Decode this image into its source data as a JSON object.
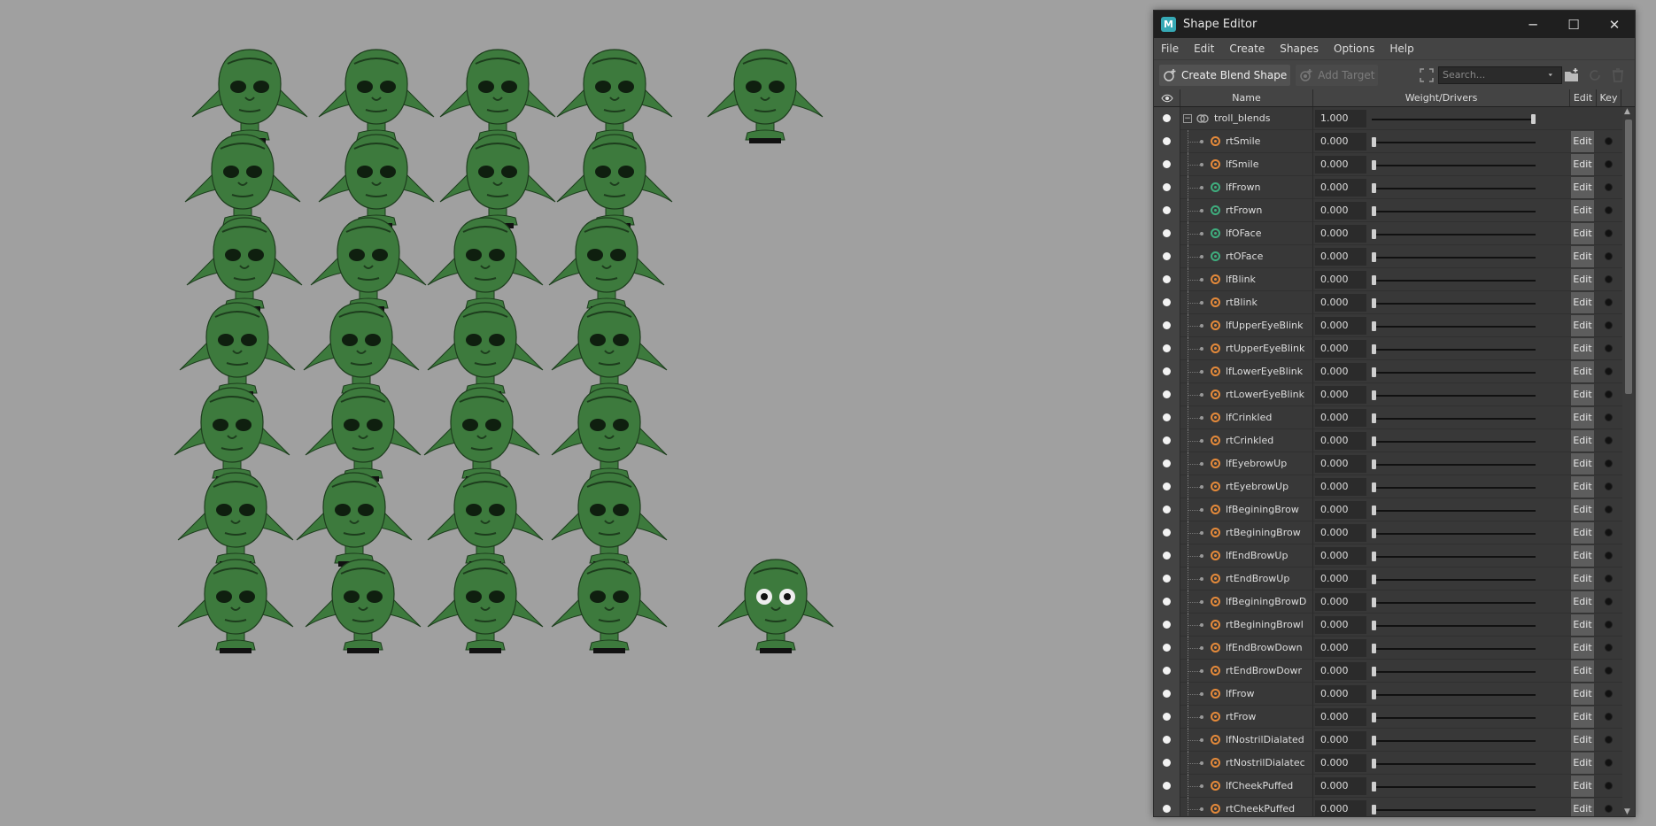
{
  "window": {
    "title": "Shape Editor",
    "app_icon_letter": "M",
    "minimize_glyph": "─",
    "maximize_glyph": "☐",
    "close_glyph": "✕"
  },
  "menu": [
    "File",
    "Edit",
    "Create",
    "Shapes",
    "Options",
    "Help"
  ],
  "toolbar": {
    "create_blend_shape": "Create Blend Shape",
    "add_target": "Add Target",
    "search_placeholder": "Search..."
  },
  "table": {
    "headers": {
      "name": "Name",
      "weight": "Weight/Drivers",
      "edit": "Edit",
      "key": "Key"
    },
    "group": {
      "name": "troll_blends",
      "weight": "1.000",
      "weight_fraction": 1.0
    },
    "edit_label": "Edit",
    "targets": [
      {
        "name": "rtSmile",
        "weight": "0.000",
        "icon": "orange"
      },
      {
        "name": "lfSmile",
        "weight": "0.000",
        "icon": "orange"
      },
      {
        "name": "lfFrown",
        "weight": "0.000",
        "icon": "green"
      },
      {
        "name": "rtFrown",
        "weight": "0.000",
        "icon": "green"
      },
      {
        "name": "lfOFace",
        "weight": "0.000",
        "icon": "green"
      },
      {
        "name": "rtOFace",
        "weight": "0.000",
        "icon": "green"
      },
      {
        "name": "lfBlink",
        "weight": "0.000",
        "icon": "orange"
      },
      {
        "name": "rtBlink",
        "weight": "0.000",
        "icon": "orange"
      },
      {
        "name": "lfUpperEyeBlink",
        "weight": "0.000",
        "icon": "orange"
      },
      {
        "name": "rtUpperEyeBlink",
        "weight": "0.000",
        "icon": "orange"
      },
      {
        "name": "lfLowerEyeBlink",
        "weight": "0.000",
        "icon": "orange"
      },
      {
        "name": "rtLowerEyeBlink",
        "weight": "0.000",
        "icon": "orange"
      },
      {
        "name": "lfCrinkled",
        "weight": "0.000",
        "icon": "orange"
      },
      {
        "name": "rtCrinkled",
        "weight": "0.000",
        "icon": "orange"
      },
      {
        "name": "lfEyebrowUp",
        "weight": "0.000",
        "icon": "orange"
      },
      {
        "name": "rtEyebrowUp",
        "weight": "0.000",
        "icon": "orange"
      },
      {
        "name": "lfBeginingBrow",
        "weight": "0.000",
        "icon": "orange"
      },
      {
        "name": "rtBeginingBrow",
        "weight": "0.000",
        "icon": "orange"
      },
      {
        "name": "lfEndBrowUp",
        "weight": "0.000",
        "icon": "orange"
      },
      {
        "name": "rtEndBrowUp",
        "weight": "0.000",
        "icon": "orange"
      },
      {
        "name": "lfBeginingBrowD",
        "weight": "0.000",
        "icon": "orange"
      },
      {
        "name": "rtBeginingBrowl",
        "weight": "0.000",
        "icon": "orange"
      },
      {
        "name": "lfEndBrowDown",
        "weight": "0.000",
        "icon": "orange"
      },
      {
        "name": "rtEndBrowDowr",
        "weight": "0.000",
        "icon": "orange"
      },
      {
        "name": "lfFrow",
        "weight": "0.000",
        "icon": "orange"
      },
      {
        "name": "rtFrow",
        "weight": "0.000",
        "icon": "orange"
      },
      {
        "name": "lfNostrilDialated",
        "weight": "0.000",
        "icon": "orange"
      },
      {
        "name": "rtNostrilDialatec",
        "weight": "0.000",
        "icon": "orange"
      },
      {
        "name": "lfCheekPuffed",
        "weight": "0.000",
        "icon": "orange"
      },
      {
        "name": "rtCheekPuffed",
        "weight": "0.000",
        "icon": "orange"
      }
    ]
  },
  "colors": {
    "icon_orange": "#e58a3a",
    "icon_green": "#3fae7e",
    "troll_skin": "#3d7a3d",
    "troll_dark": "#1d3d1d"
  }
}
